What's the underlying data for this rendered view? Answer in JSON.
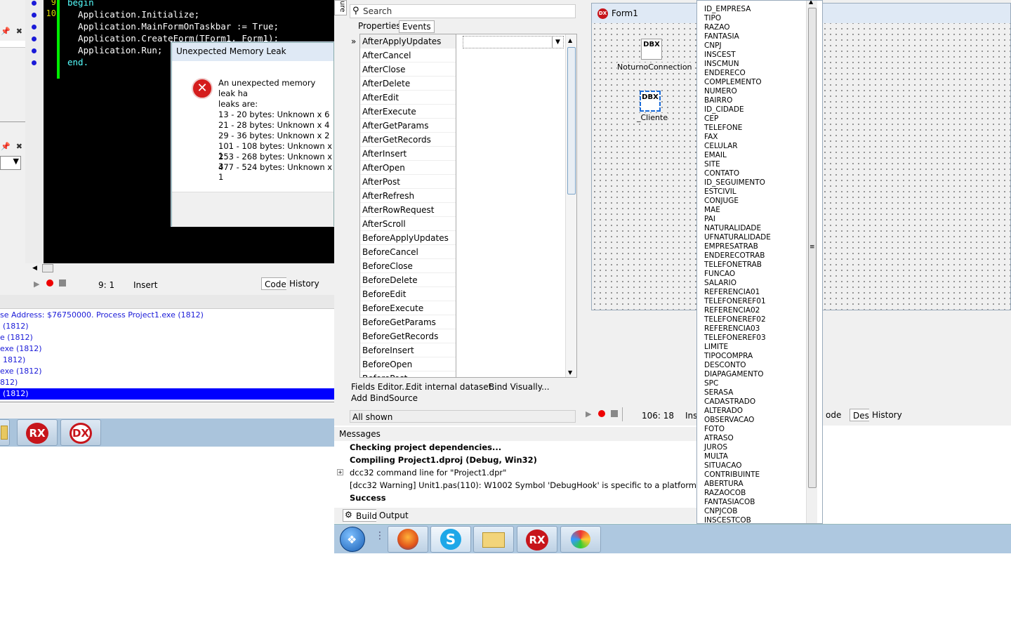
{
  "code": {
    "line_numbers": [
      "9",
      "10"
    ],
    "lines": [
      {
        "kw": "begin",
        "text": ""
      },
      {
        "kw": "",
        "text": "  Application.Initialize;"
      },
      {
        "kw": "",
        "text": "  Application.MainFormOnTaskbar := True;"
      },
      {
        "kw": "",
        "text": "  Application.CreateForm(TForm1, Form1);"
      },
      {
        "kw": "",
        "text": "  Application.Run;"
      },
      {
        "kw": "end.",
        "text": ""
      }
    ]
  },
  "dialog": {
    "title": "Unexpected Memory Leak",
    "message_line1": "An unexpected memory leak ha",
    "message_line2": "leaks are:",
    "leaks": [
      "13 - 20 bytes: Unknown x 6",
      "21 - 28 bytes: Unknown x 4",
      "29 - 36 bytes: Unknown x 2",
      "101 - 108 bytes: Unknown x 1",
      "253 - 268 bytes: Unknown x 3",
      "477 - 524 bytes: Unknown x 1"
    ]
  },
  "editor_status": {
    "position": "9:  1",
    "mode": "Insert",
    "tab_code": "Code",
    "tab_history": "History"
  },
  "event_log": [
    "se Address: $76750000. Process Project1.exe (1812)",
    "(1812)",
    "e (1812)",
    "exe (1812)",
    "1812)",
    "exe (1812)",
    "812)",
    "(1812)"
  ],
  "object_inspector": {
    "search_placeholder": "Search",
    "tab_properties": "Properties",
    "tab_events": "Events",
    "events": [
      "AfterApplyUpdates",
      "AfterCancel",
      "AfterClose",
      "AfterDelete",
      "AfterEdit",
      "AfterExecute",
      "AfterGetParams",
      "AfterGetRecords",
      "AfterInsert",
      "AfterOpen",
      "AfterPost",
      "AfterRefresh",
      "AfterRowRequest",
      "AfterScroll",
      "BeforeApplyUpdates",
      "BeforeCancel",
      "BeforeClose",
      "BeforeDelete",
      "BeforeEdit",
      "BeforeExecute",
      "BeforeGetParams",
      "BeforeGetRecords",
      "BeforeInsert",
      "BeforeOpen",
      "BeforePost"
    ],
    "link_fields_editor": "Fields Editor...",
    "link_edit_dataset": "Edit internal dataset...",
    "link_bind_visually": "Bind Visually...",
    "link_add_bindsource": "Add BindSource",
    "filter_status": "All shown",
    "side_tab": "ure"
  },
  "messages": {
    "header": "Messages",
    "lines": [
      {
        "text": "Checking project dependencies...",
        "bold": true
      },
      {
        "text": "Compiling Project1.dproj (Debug, Win32)",
        "bold": true
      },
      {
        "text": "dcc32 command line for \"Project1.dpr\"",
        "bold": false
      },
      {
        "text": "[dcc32 Warning] Unit1.pas(110): W1002 Symbol 'DebugHook' is specific to a platform",
        "bold": false
      },
      {
        "text": "Success",
        "bold": true
      }
    ],
    "tab_build": "Build",
    "tab_output": "Output"
  },
  "designer": {
    "form_title": "Form1",
    "form_icon_text": "DX",
    "component1_label": "NoturnoConnection",
    "component2_label": "_Cliente",
    "component_icon_text": "DBX",
    "position": "106: 18",
    "mode_partial": "Ins",
    "tab_code_partial": "ode",
    "tab_design": "Design",
    "tab_history": "History"
  },
  "field_list": [
    "ID_EMPRESA",
    "TIPO",
    "RAZAO",
    "FANTASIA",
    "CNPJ",
    "INSCEST",
    "INSCMUN",
    "ENDERECO",
    "COMPLEMENTO",
    "NUMERO",
    "BAIRRO",
    "ID_CIDADE",
    "CEP",
    "TELEFONE",
    "FAX",
    "CELULAR",
    "EMAIL",
    "SITE",
    "CONTATO",
    "ID_SEGUIMENTO",
    "ESTCIVIL",
    "CONJUGE",
    "MAE",
    "PAI",
    "NATURALIDADE",
    "UFNATURALIDADE",
    "EMPRESATRAB",
    "ENDERECOTRAB",
    "TELEFONETRAB",
    "FUNCAO",
    "SALARIO",
    "REFERENCIA01",
    "TELEFONEREF01",
    "REFERENCIA02",
    "TELEFONEREF02",
    "REFERENCIA03",
    "TELEFONEREF03",
    "LIMITE",
    "TIPOCOMPRA",
    "DESCONTO",
    "DIAPAGAMENTO",
    "SPC",
    "SERASA",
    "CADASTRADO",
    "ALTERADO",
    "OBSERVACAO",
    "FOTO",
    "ATRASO",
    "JUROS",
    "MULTA",
    "SITUACAO",
    "CONTRIBUINTE",
    "ABERTURA",
    "RAZAOCOB",
    "FANTASIACOB",
    "CNPJCOB",
    "INSCESTCOB"
  ],
  "taskbar_left": [
    {
      "icon": "folder-icon"
    },
    {
      "icon": "rx-app-icon",
      "text": "RX"
    },
    {
      "icon": "dx-app-icon",
      "text": "DX"
    }
  ],
  "taskbar": {
    "rx_text": "RX",
    "dx_text": "DX",
    "skype_text": "S"
  },
  "colors": {
    "selection_blue": "#0000ff",
    "code_background": "#000000",
    "taskbar": "#aec8e0",
    "error_red": "#d41c1c"
  }
}
